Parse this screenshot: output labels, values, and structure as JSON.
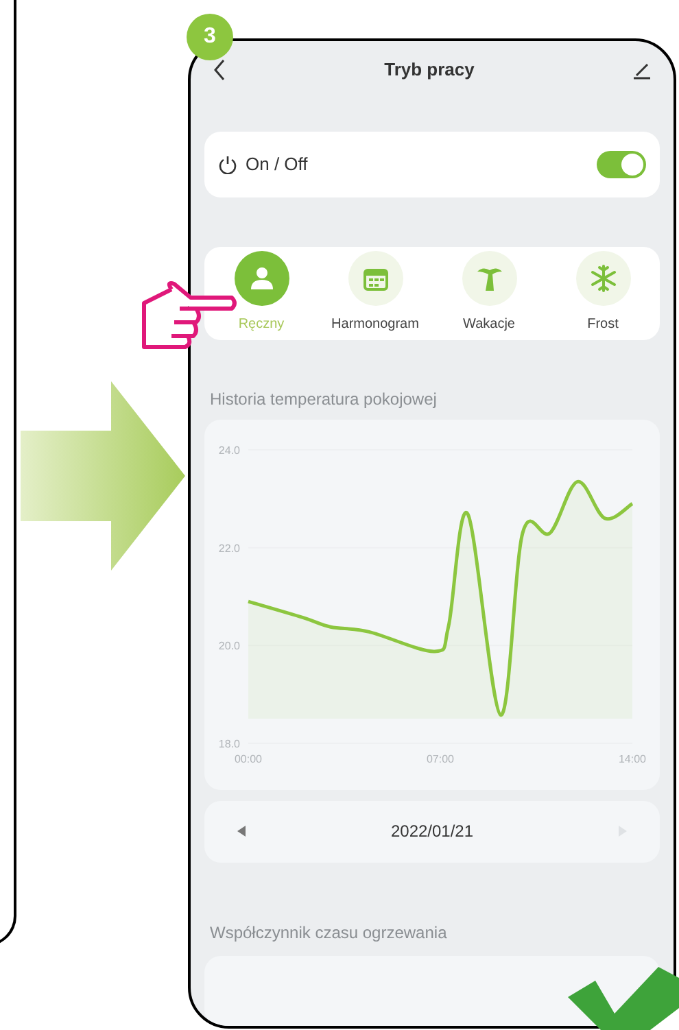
{
  "step_badge": "3",
  "header": {
    "title": "Tryb pracy"
  },
  "power": {
    "label": "On / Off",
    "on": true
  },
  "modes": [
    {
      "label": "Ręczny",
      "kind": "person",
      "selected": true
    },
    {
      "label": "Harmonogram",
      "kind": "calendar",
      "selected": false
    },
    {
      "label": "Wakacje",
      "kind": "palm",
      "selected": false
    },
    {
      "label": "Frost",
      "kind": "snowflake",
      "selected": false
    }
  ],
  "history": {
    "title": "Historia temperatura pokojowej",
    "chart_data": {
      "type": "area",
      "x": [
        0,
        2,
        3,
        4.4,
        6.8,
        7.3,
        8,
        9.2,
        10,
        11,
        12,
        13,
        14
      ],
      "series": [
        {
          "color": "#8cc63f",
          "values": [
            20.9,
            20.57,
            20.38,
            20.28,
            19.88,
            20.4,
            22.69,
            18.58,
            22.3,
            22.3,
            23.35,
            22.6,
            22.9
          ]
        }
      ],
      "xlim": [
        0,
        14
      ],
      "ylim": [
        18,
        24
      ],
      "yticks": [
        {
          "value": 18,
          "label": "18.0"
        },
        {
          "value": 20,
          "label": "20.0"
        },
        {
          "value": 22,
          "label": "22.0"
        },
        {
          "value": 24,
          "label": "24.0"
        }
      ],
      "xticks": [
        {
          "value": 0,
          "label": "00:00"
        },
        {
          "value": 7,
          "label": "07:00"
        },
        {
          "value": 14,
          "label": "14:00"
        }
      ]
    }
  },
  "date_nav": {
    "date": "2022/01/21",
    "next_disabled": true
  },
  "heating_factor": {
    "title": "Współczynnik czasu ogrzewania"
  }
}
